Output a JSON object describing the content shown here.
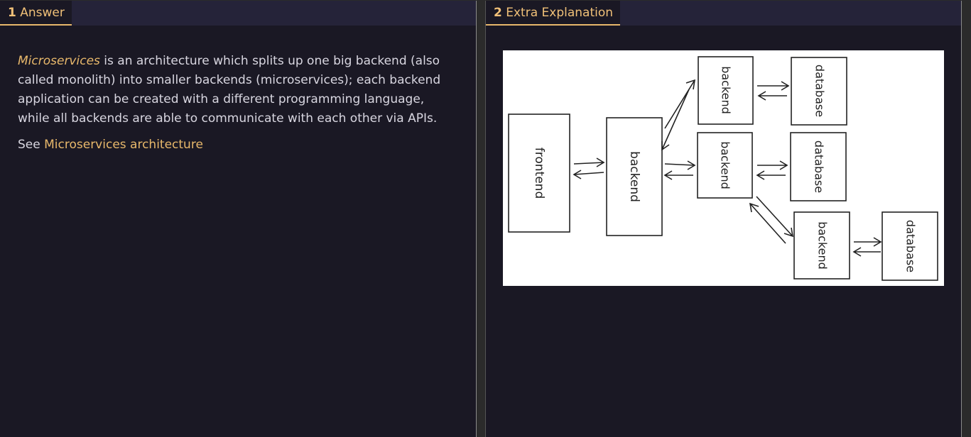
{
  "tabs": [
    {
      "number": "1",
      "label": "Answer"
    },
    {
      "number": "2",
      "label": "Extra Explanation"
    }
  ],
  "answer": {
    "term": "Microservices",
    "text": " is an architecture which splits up one big backend (also called monolith) into smaller backends (microservices); each backend application can be created with a different programming language, while all backends are able to communicate with each other via APIs.",
    "see_prefix": "See ",
    "see_link": "Microservices architecture"
  },
  "diagram": {
    "frontend": "frontend",
    "backend": "backend",
    "database": "database"
  }
}
